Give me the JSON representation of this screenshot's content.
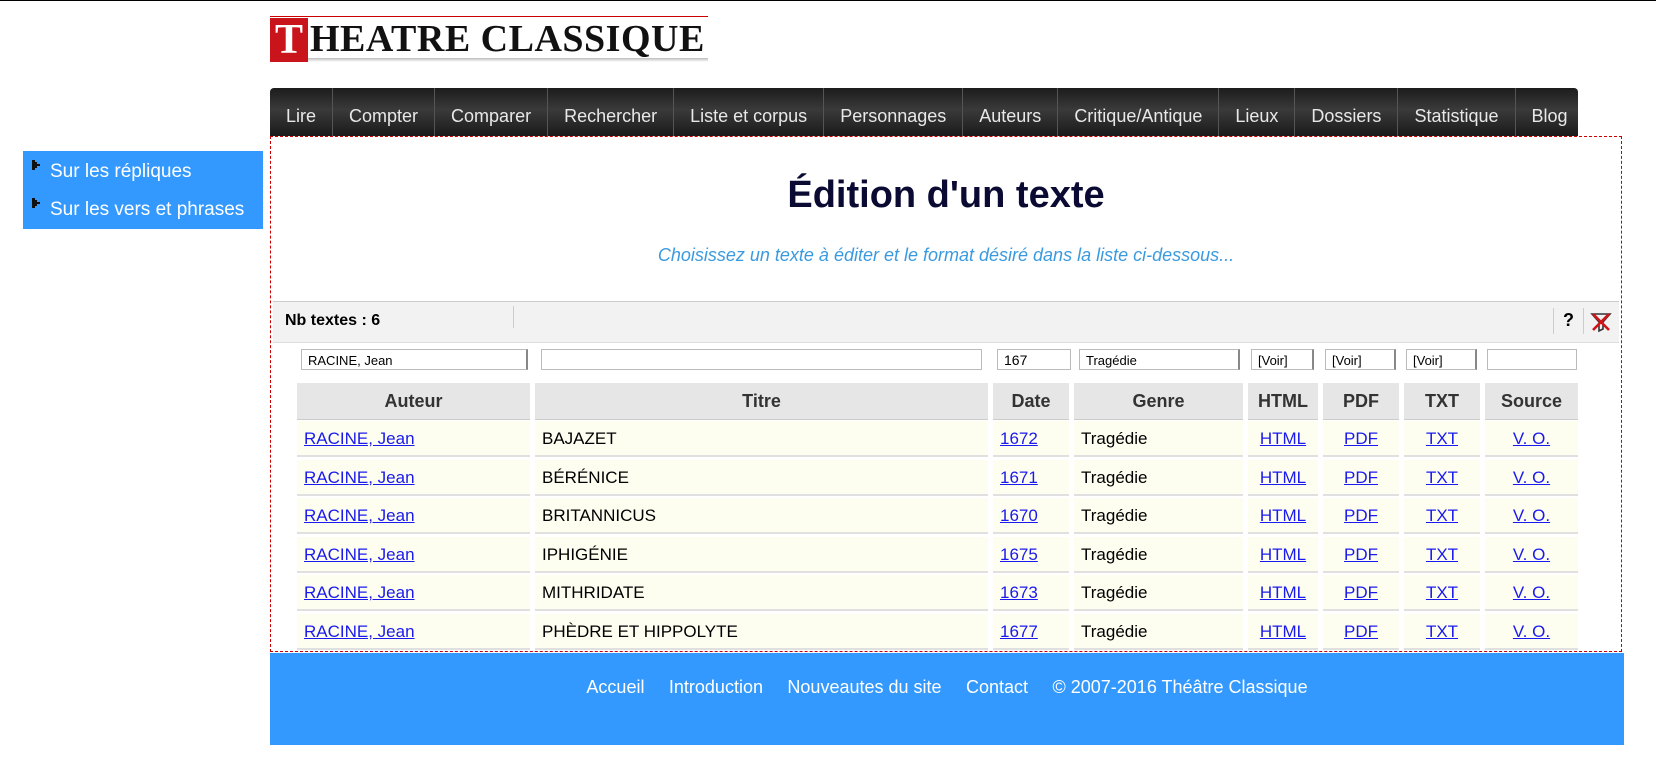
{
  "logo": {
    "letter": "T",
    "text": "HEATRE CLASSIQUE"
  },
  "nav": [
    "Lire",
    "Compter",
    "Comparer",
    "Rechercher",
    "Liste et corpus",
    "Personnages",
    "Auteurs",
    "Critique/Antique",
    "Lieux",
    "Dossiers",
    "Statistique",
    "Blog"
  ],
  "sidebar": [
    "Sur les répliques",
    "Sur les vers et phrases"
  ],
  "page": {
    "title": "Édition d'un texte",
    "subtitle": "Choisissez un texte à éditer et le format désiré dans la liste ci-dessous..."
  },
  "toolbar": {
    "count_label": "Nb textes : 6",
    "help": "?"
  },
  "filters": {
    "auteur": "RACINE, Jean",
    "titre": "",
    "date": "167",
    "genre": "Tragédie",
    "html": "[Voir]",
    "pdf": "[Voir]",
    "txt": "[Voir]",
    "source": ""
  },
  "columns": [
    "Auteur",
    "Titre",
    "Date",
    "Genre",
    "HTML",
    "PDF",
    "TXT",
    "Source"
  ],
  "rows": [
    {
      "auteur": "RACINE, Jean",
      "titre": "BAJAZET",
      "date": "1672",
      "genre": "Tragédie",
      "html": "HTML",
      "pdf": "PDF",
      "txt": "TXT",
      "source": "V. O."
    },
    {
      "auteur": "RACINE, Jean",
      "titre": "BÉRÉNICE",
      "date": "1671",
      "genre": "Tragédie",
      "html": "HTML",
      "pdf": "PDF",
      "txt": "TXT",
      "source": "V. O."
    },
    {
      "auteur": "RACINE, Jean",
      "titre": "BRITANNICUS",
      "date": "1670",
      "genre": "Tragédie",
      "html": "HTML",
      "pdf": "PDF",
      "txt": "TXT",
      "source": "V. O."
    },
    {
      "auteur": "RACINE, Jean",
      "titre": "IPHIGÉNIE",
      "date": "1675",
      "genre": "Tragédie",
      "html": "HTML",
      "pdf": "PDF",
      "txt": "TXT",
      "source": "V. O."
    },
    {
      "auteur": "RACINE, Jean",
      "titre": "MITHRIDATE",
      "date": "1673",
      "genre": "Tragédie",
      "html": "HTML",
      "pdf": "PDF",
      "txt": "TXT",
      "source": "V. O."
    },
    {
      "auteur": "RACINE, Jean",
      "titre": "PHÈDRE ET HIPPOLYTE",
      "date": "1677",
      "genre": "Tragédie",
      "html": "HTML",
      "pdf": "PDF",
      "txt": "TXT",
      "source": "V. O."
    }
  ],
  "footer": {
    "links": [
      "Accueil",
      "Introduction",
      "Nouveautes du site",
      "Contact"
    ],
    "copyright": "© 2007-2016 Théâtre Classique"
  },
  "colors": {
    "brand_red": "#c8141a",
    "accent_blue": "#3399ff",
    "nav_dark": "#2a2a2a",
    "link": "#1a1aee",
    "row_bg": "#fdfdf0"
  }
}
